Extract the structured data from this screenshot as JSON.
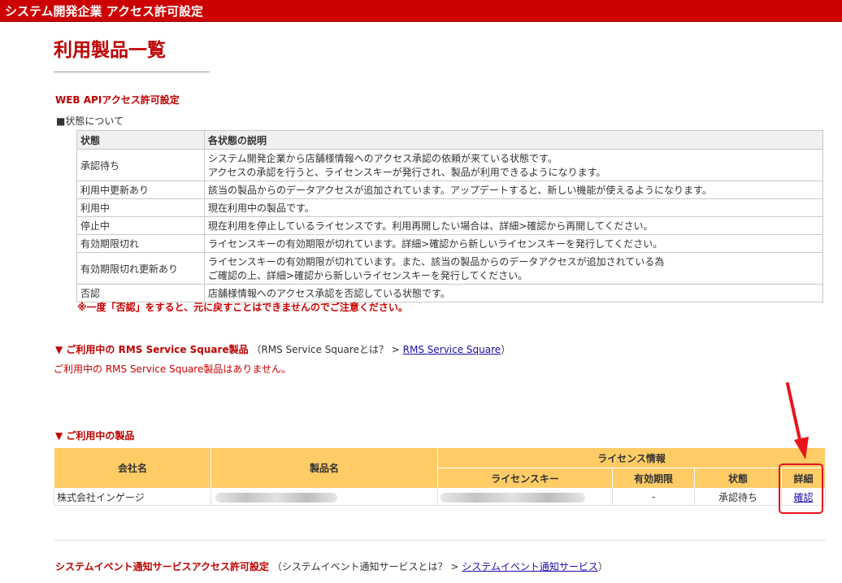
{
  "header": {
    "title": "システム開発企業 アクセス許可設定"
  },
  "page": {
    "title": "利用製品一覧"
  },
  "api_section": {
    "title": "WEB APIアクセス許可設定",
    "legend_label": "■状態について",
    "table": {
      "headers": [
        "状態",
        "各状態の説明"
      ],
      "rows": [
        {
          "status": "承認待ち",
          "desc1": "システム開発企業から店舗様情報へのアクセス承認の依頼が来ている状態です。",
          "desc2": "アクセスの承認を行うと、ライセンスキーが発行され、製品が利用できるようになります。"
        },
        {
          "status": "利用中更新あり",
          "desc1": "該当の製品からのデータアクセスが追加されています。アップデートすると、新しい機能が使えるようになります。"
        },
        {
          "status": "利用中",
          "desc1": "現在利用中の製品です。"
        },
        {
          "status": "停止中",
          "desc1": "現在利用を停止しているライセンスです。利用再開したい場合は、詳細>確認から再開してください。"
        },
        {
          "status": "有効期限切れ",
          "desc1": "ライセンスキーの有効期限が切れています。詳細>確認から新しいライセンスキーを発行してください。"
        },
        {
          "status": "有効期限切れ更新あり",
          "desc1": "ライセンスキーの有効期限が切れています。また、該当の製品からのデータアクセスが追加されている為",
          "desc2": "ご確認の上、詳細>確認から新しいライセンスキーを発行してください。"
        },
        {
          "status": "否認",
          "desc1": "店舗様情報へのアクセス承認を否認している状態です。"
        }
      ]
    },
    "warning": "※一度「否認」をすると、元に戻すことはできませんのでご注意ください。"
  },
  "rms_section": {
    "heading": "▼ ご利用中の RMS Service Square製品",
    "note_prefix": "（RMS Service Squareとは？ > ",
    "link": "RMS Service Square",
    "note_suffix": "）",
    "empty": "ご利用中の RMS Service Square製品はありません。"
  },
  "products_section": {
    "heading": "▼ ご利用中の製品",
    "table": {
      "h_company": "会社名",
      "h_product": "製品名",
      "h_license_info": "ライセンス情報",
      "h_license_key": "ライセンスキー",
      "h_expiry": "有効期限",
      "h_status": "状態",
      "h_detail": "詳細",
      "row": {
        "company": "株式会社インゲージ",
        "expiry": "-",
        "status": "承認待ち",
        "detail_link": "確認"
      }
    }
  },
  "event_section": {
    "heading": "システムイベント通知サービスアクセス許可設定",
    "note_prefix": "（システムイベント通知サービスとは？ > ",
    "link": "システムイベント通知サービス",
    "note_suffix": "）"
  },
  "colors": {
    "brand_red": "#cc0000",
    "table_header_orange": "#ffcc66",
    "annotation_red": "#e8141b",
    "link_blue": "#1a0dab"
  }
}
